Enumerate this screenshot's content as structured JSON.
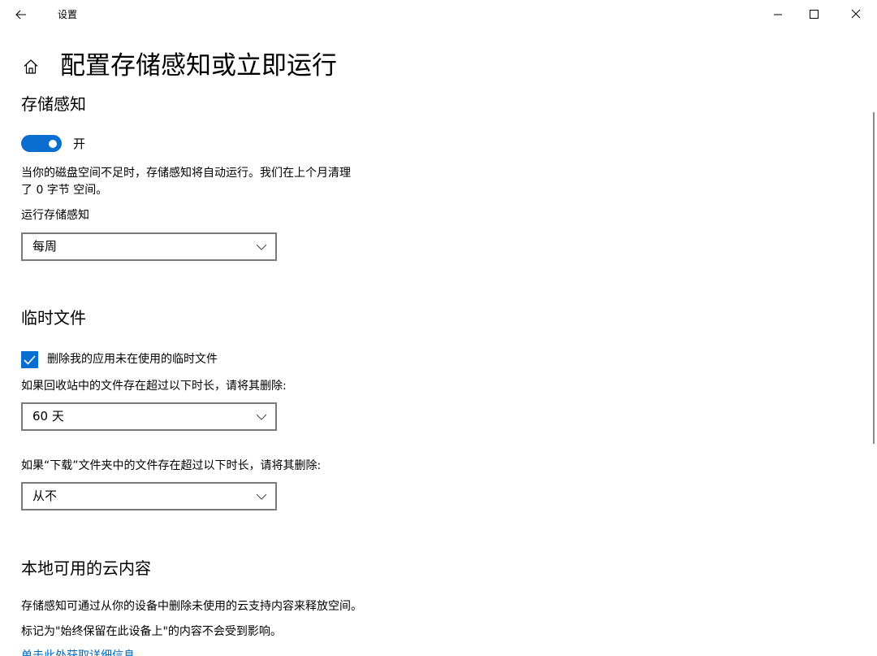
{
  "window": {
    "title": "设置"
  },
  "header": {
    "title": "配置存储感知或立即运行"
  },
  "storage_sense": {
    "heading": "存储感知",
    "toggle_state": "开",
    "toggle_on": true,
    "description_line1": "当你的磁盘空间不足时，存储感知将自动运行。我们在上个月清理",
    "description_line2": "了 0 字节 空间。",
    "run_label": "运行存储感知",
    "run_value": "每周"
  },
  "temp_files": {
    "heading": "临时文件",
    "delete_temp_label": "删除我的应用未在使用的临时文件",
    "delete_temp_checked": true,
    "recycle_label": "如果回收站中的文件存在超过以下时长，请将其删除:",
    "recycle_value": "60 天",
    "downloads_label": "如果“下载”文件夹中的文件存在超过以下时长，请将其删除:",
    "downloads_value": "从不"
  },
  "cloud": {
    "heading": "本地可用的云内容",
    "description_line1": "存储感知可通过从你的设备中删除未使用的云支持内容来释放空间。",
    "description_line2": "标记为\"始终保留在此设备上\"的内容不会受到影响。",
    "link": "单击此处获取详细信息"
  },
  "icons": {
    "back": "back-arrow-icon",
    "home": "home-icon",
    "minimize": "minimize-icon",
    "maximize": "maximize-icon",
    "close": "close-icon",
    "chevron": "chevron-down-icon",
    "check": "checkmark-icon"
  },
  "colors": {
    "accent": "#0a6ed1",
    "link": "#0067b8",
    "border": "#7a7a7a"
  }
}
